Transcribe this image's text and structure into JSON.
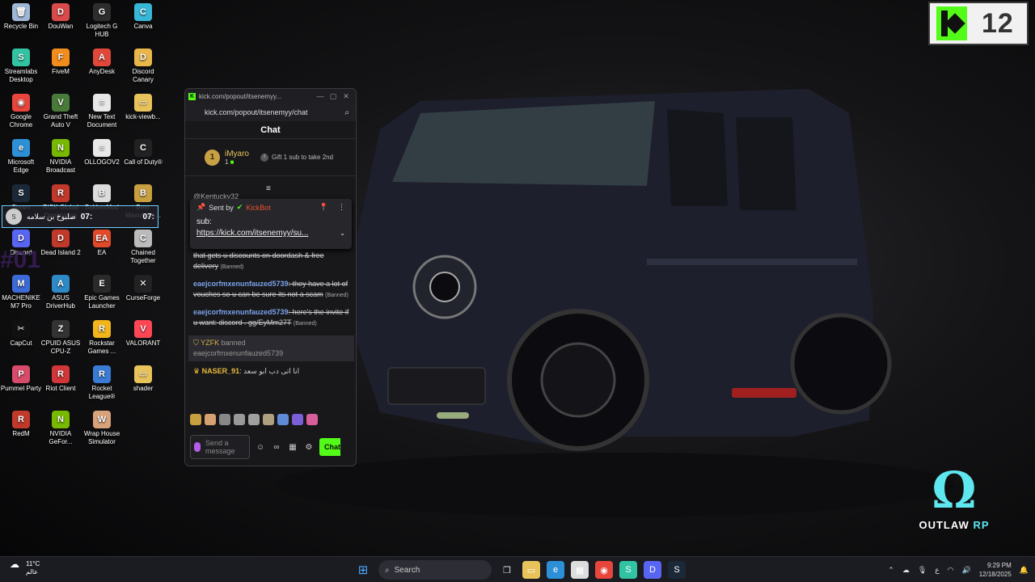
{
  "desktop": {
    "icons": [
      {
        "label": "Recycle Bin",
        "icon": "recycle-bin-icon",
        "color": "#9fb7d6",
        "glyph": "🗑"
      },
      {
        "label": "DouWan",
        "icon": "douwan-icon",
        "color": "#d94b4b",
        "glyph": "D"
      },
      {
        "label": "Logitech G HUB",
        "icon": "logitech-icon",
        "color": "#2d2d2d",
        "glyph": "G"
      },
      {
        "label": "Canva",
        "icon": "canva-icon",
        "color": "#37b6d6",
        "glyph": "C"
      },
      {
        "label": "Streamlabs Desktop",
        "icon": "streamlabs-icon",
        "color": "#31c3a2",
        "glyph": "S"
      },
      {
        "label": "FiveM",
        "icon": "fivem-icon",
        "color": "#f28c1c",
        "glyph": "F"
      },
      {
        "label": "AnyDesk",
        "icon": "anydesk-icon",
        "color": "#e0483a",
        "glyph": "A"
      },
      {
        "label": "Discord Canary",
        "icon": "discord-canary-icon",
        "color": "#e8b64a",
        "glyph": "D"
      },
      {
        "label": "Google Chrome",
        "icon": "chrome-icon",
        "color": "#e8453c",
        "glyph": "◉"
      },
      {
        "label": "Grand Theft Auto V",
        "icon": "gta-icon",
        "color": "#4a7a3a",
        "glyph": "V"
      },
      {
        "label": "New Text Document",
        "icon": "text-document-icon",
        "color": "#e8e8e8",
        "glyph": "≡"
      },
      {
        "label": "kick-viewb...",
        "icon": "folder-icon",
        "color": "#e8c25a",
        "glyph": "▭"
      },
      {
        "label": "Microsoft Edge",
        "icon": "edge-icon",
        "color": "#2d8fd6",
        "glyph": "e"
      },
      {
        "label": "NVIDIA Broadcast",
        "icon": "nvidia-icon",
        "color": "#76b900",
        "glyph": "N"
      },
      {
        "label": "OLLOGOV2",
        "icon": "document-icon",
        "color": "#e8e8e8",
        "glyph": "≡"
      },
      {
        "label": "Call of Duty®",
        "icon": "cod-icon",
        "color": "#222222",
        "glyph": "C"
      },
      {
        "label": "Steam",
        "icon": "steam-icon",
        "color": "#1b2838",
        "glyph": "S"
      },
      {
        "label": "RISK Global Domination",
        "icon": "risk-icon",
        "color": "#c0392b",
        "glyph": "R"
      },
      {
        "label": "BakkesMod",
        "icon": "bakkesmod-icon",
        "color": "#dcdcdc",
        "glyph": "B"
      },
      {
        "label": "Beer Manufactu...",
        "icon": "beer-icon",
        "color": "#c8a040",
        "glyph": "B"
      },
      {
        "label": "Discord",
        "icon": "discord-icon",
        "color": "#5865f2",
        "glyph": "D"
      },
      {
        "label": "Dead Island 2",
        "icon": "dead-island-icon",
        "color": "#c0392b",
        "glyph": "D"
      },
      {
        "label": "EA",
        "icon": "ea-icon",
        "color": "#e24a2a",
        "glyph": "EA"
      },
      {
        "label": "Chained Together",
        "icon": "chained-icon",
        "color": "#bbbbbb",
        "glyph": "C"
      },
      {
        "label": "MACHENIKE M7 Pro",
        "icon": "machenike-icon",
        "color": "#3c6ad6",
        "glyph": "M"
      },
      {
        "label": "ASUS DriverHub",
        "icon": "asus-icon",
        "color": "#2e89c7",
        "glyph": "A"
      },
      {
        "label": "Epic Games Launcher",
        "icon": "epic-icon",
        "color": "#2a2a2a",
        "glyph": "E"
      },
      {
        "label": "CurseForge",
        "icon": "curseforge-icon",
        "color": "#222222",
        "glyph": "✕"
      },
      {
        "label": "CapCut",
        "icon": "capcut-icon",
        "color": "#111111",
        "glyph": "✂"
      },
      {
        "label": "CPUID ASUS CPU-Z",
        "icon": "cpuz-icon",
        "color": "#333333",
        "glyph": "Z"
      },
      {
        "label": "Rockstar Games ...",
        "icon": "rockstar-icon",
        "color": "#f2b51c",
        "glyph": "R"
      },
      {
        "label": "VALORANT",
        "icon": "valorant-icon",
        "color": "#ff4655",
        "glyph": "V"
      },
      {
        "label": "Pummel Party",
        "icon": "pummel-icon",
        "color": "#d94b6a",
        "glyph": "P"
      },
      {
        "label": "Riot Client",
        "icon": "riot-icon",
        "color": "#d13639",
        "glyph": "R"
      },
      {
        "label": "Rocket League®",
        "icon": "rocket-league-icon",
        "color": "#3a7bd5",
        "glyph": "R"
      },
      {
        "label": "shader",
        "icon": "folder-icon",
        "color": "#e8c25a",
        "glyph": "▭"
      },
      {
        "label": "RedM",
        "icon": "redm-icon",
        "color": "#c0392b",
        "glyph": "R"
      },
      {
        "label": "NVIDIA GeFor...",
        "icon": "geforce-icon",
        "color": "#76b900",
        "glyph": "N"
      },
      {
        "label": "Wrap House Simulator",
        "icon": "wrap-house-icon",
        "color": "#d8a37a",
        "glyph": "W"
      }
    ]
  },
  "overlay": {
    "name": "صلبوخ بن سلامه",
    "time1": "07:",
    "time2": "07:",
    "side_text": "#01"
  },
  "logos": {
    "k12_number": "12",
    "outlaw_text": "OUTLAW",
    "outlaw_rp": "RP"
  },
  "chat": {
    "tab_title": "kick.com/popout/itsenemyy...",
    "url": "kick.com/popout/itsenemyy/chat",
    "header": "Chat",
    "leader_name": "iMyaro",
    "leader_count": "1",
    "leader_rank": "1",
    "gift_text": "Gift 1 sub to take 2nd",
    "gift_rank": "2",
    "behind_text": "@Kentucky32",
    "pinned": {
      "sent_by": "Sent by",
      "bot_name": "KickBot",
      "body_prefix": "sub:",
      "link": "https://kick.com/itsenemyy/su..."
    },
    "messages": [
      {
        "user": "",
        "text": "that gets u discounts on doordash & free delivery",
        "banned": "(Banned)"
      },
      {
        "user": "eaejcorfmxenunfauzed5739",
        "text": ": they have a lot of vouches so u can be sure its not a scam",
        "banned": "(Banned)"
      },
      {
        "user": "eaejcorfmxenunfauzed5739",
        "text": ": here's the invite if u want: discord . gg/EyMm27T",
        "banned": "(Banned)"
      }
    ],
    "mod_note": {
      "mod": "YZFK",
      "action": "banned",
      "target": "eaejcorfmxenunfauzed5739"
    },
    "last_message": {
      "user": "NASER_91",
      "text": ": انا اتى دب ابو سعد"
    },
    "input_placeholder": "Send a message",
    "send_label": "Chat",
    "emote_colors": [
      "#c8a040",
      "#d6a070",
      "#888888",
      "#999999",
      "#a0a0a0",
      "#b0a080",
      "#5f8bd6",
      "#7a5fd6",
      "#d65f9a"
    ]
  },
  "taskbar": {
    "weather_temp": "11°C",
    "weather_desc": "عالم",
    "search_label": "Search",
    "time": "9:29 PM",
    "date": "12/18/2025",
    "lang": "ع",
    "apps": [
      {
        "icon": "file-explorer-icon",
        "color": "#e8c25a",
        "glyph": "▭"
      },
      {
        "icon": "edge-icon",
        "color": "#2d8fd6",
        "glyph": "e"
      },
      {
        "icon": "store-icon",
        "color": "#dddddd",
        "glyph": "▦"
      },
      {
        "icon": "chrome-icon",
        "color": "#e8453c",
        "glyph": "◉"
      },
      {
        "icon": "streamlabs-icon",
        "color": "#31c3a2",
        "glyph": "S"
      },
      {
        "icon": "discord-icon",
        "color": "#5865f2",
        "glyph": "D"
      },
      {
        "icon": "steam-icon",
        "color": "#1b2838",
        "glyph": "S"
      }
    ]
  }
}
